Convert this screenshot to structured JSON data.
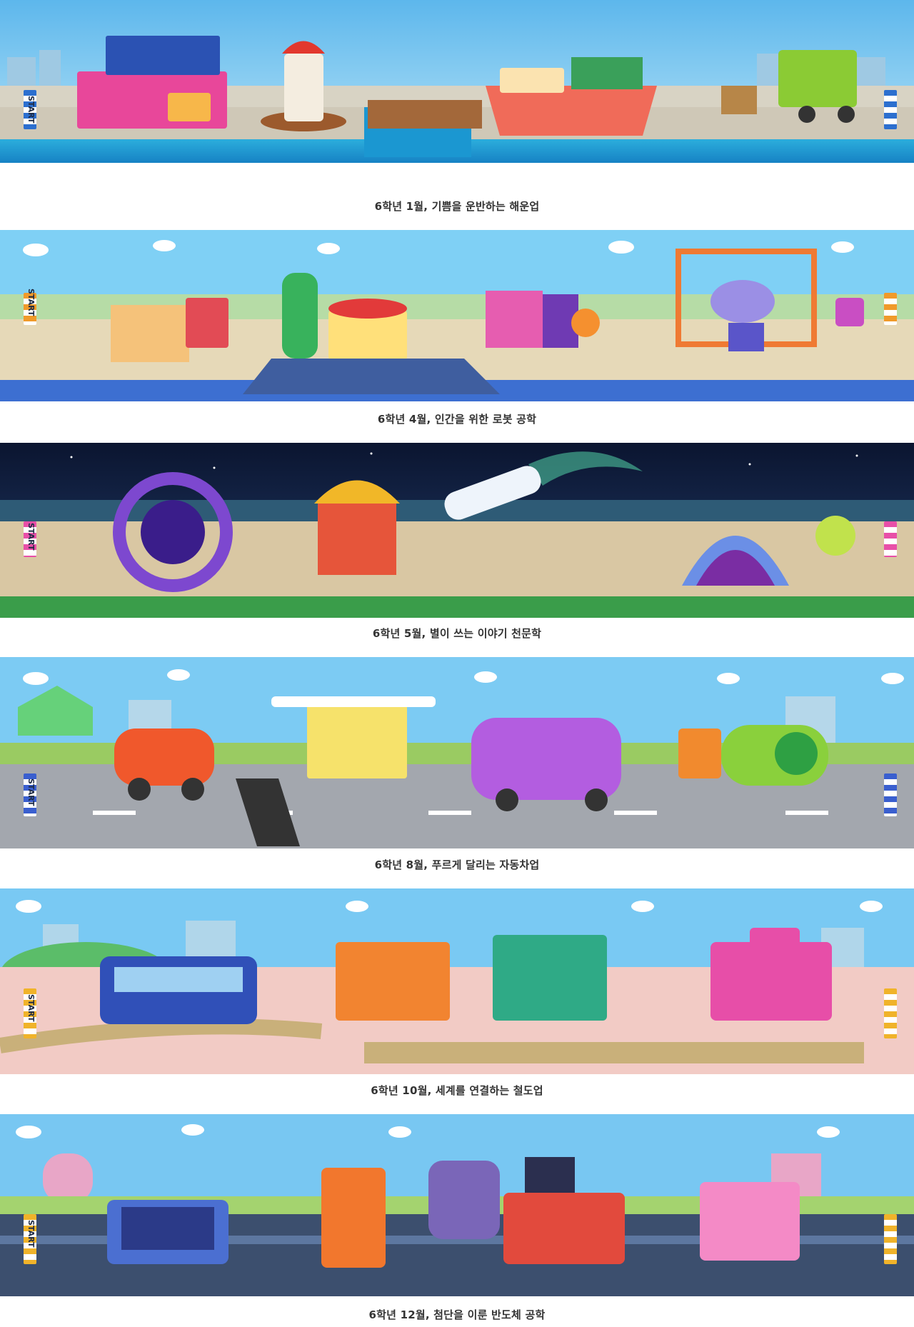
{
  "start_label": "START",
  "scenes": [
    {
      "id": "shipping",
      "caption": "6학년 1월, 기쁨을 운반하는 해운업",
      "theme": "harbor",
      "sky": "#6ec3f0",
      "ground": "#d7d3c6",
      "accent": "#1aa3d9"
    },
    {
      "id": "robotics",
      "caption": "6학년 4월, 인간을 위한 로봇 공학",
      "theme": "factory",
      "sky": "#7fd0f5",
      "ground": "#e6d9b8",
      "accent": "#f07d2a"
    },
    {
      "id": "astronomy",
      "caption": "6학년 5월, 별이 쓰는 이야기 천문학",
      "theme": "night",
      "sky": "#0f1c3a",
      "ground": "#d9c7a3",
      "accent": "#7a3fd0"
    },
    {
      "id": "automobile",
      "caption": "6학년 8월, 푸르게 달리는 자동차업",
      "theme": "road",
      "sky": "#7ccbf3",
      "ground": "#9ea3ab",
      "accent": "#2f9d3a"
    },
    {
      "id": "railway",
      "caption": "6학년 10월, 세계를 연결하는 철도업",
      "theme": "rail",
      "sky": "#79c9f3",
      "ground": "#f1c9c4",
      "accent": "#2b4fb3"
    },
    {
      "id": "semiconductor",
      "caption": "6학년 12월, 첨단을 이룬 반도체 공학",
      "theme": "chip",
      "sky": "#78c7f2",
      "ground": "#3c4f6e",
      "accent": "#2a6fdc"
    }
  ]
}
